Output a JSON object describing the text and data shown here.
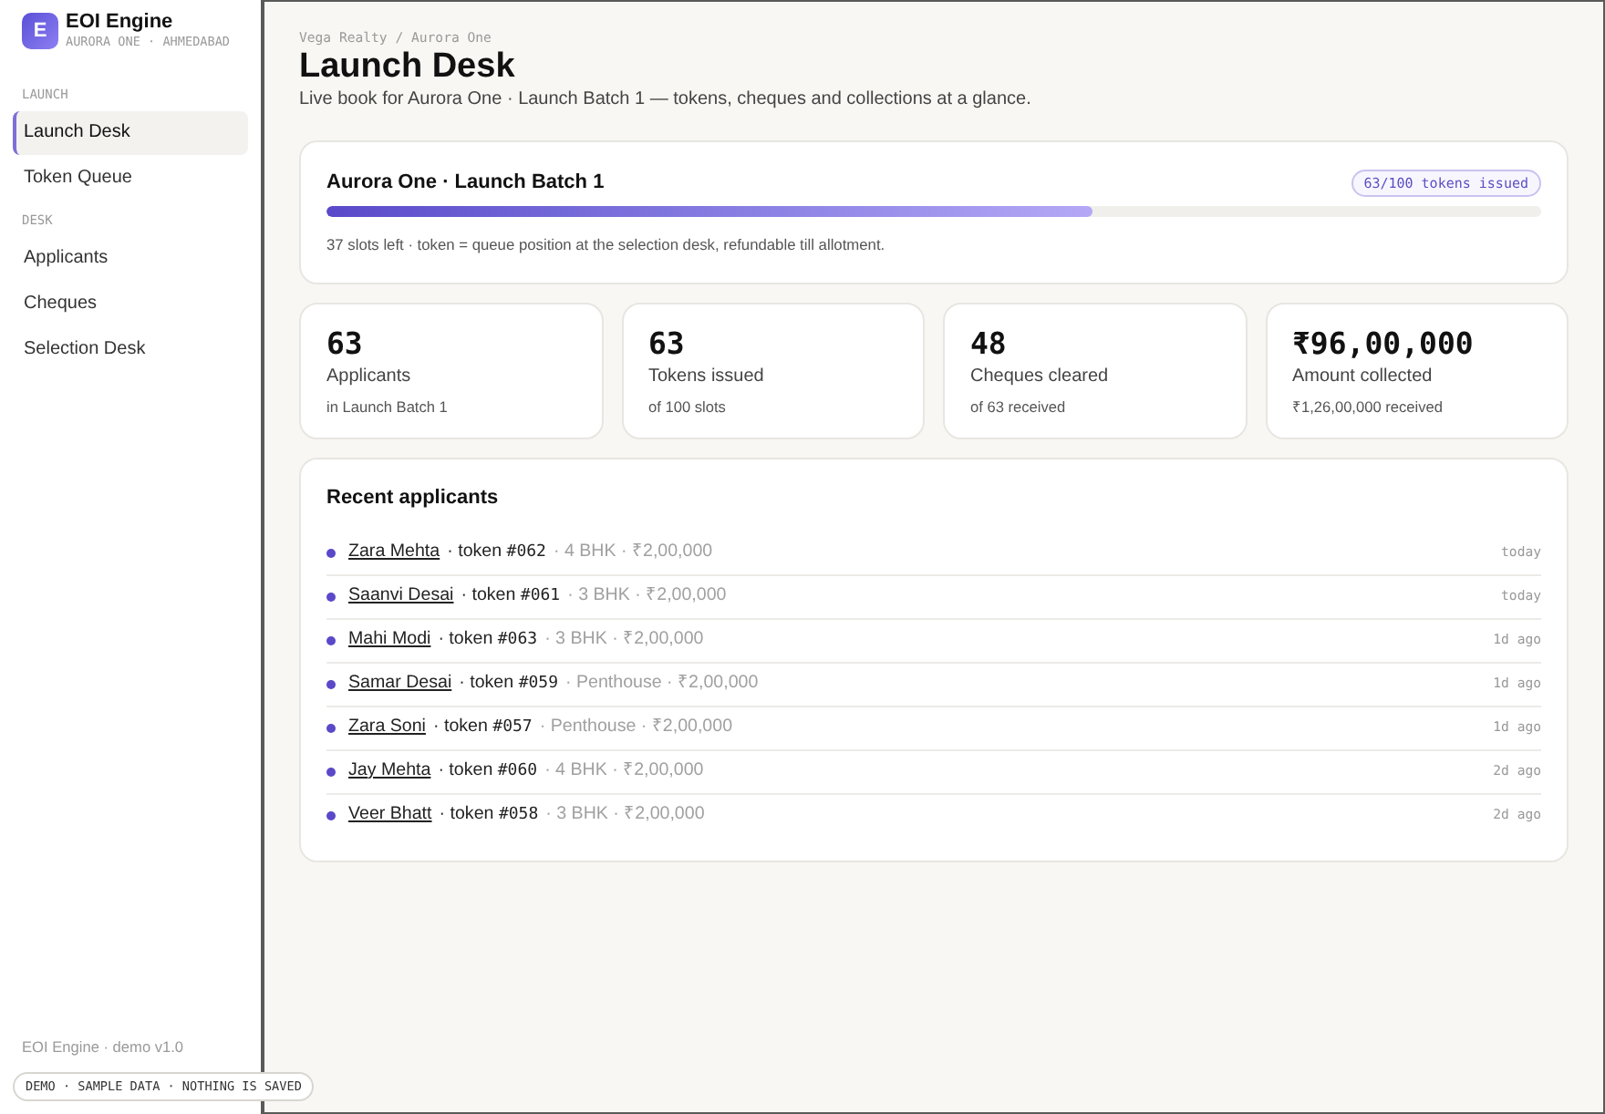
{
  "brand": {
    "logo_letter": "E",
    "name": "EOI Engine",
    "subtitle": "AURORA ONE · AHMEDABAD"
  },
  "sidebar": {
    "sections": [
      {
        "heading": "LAUNCH",
        "items": [
          {
            "label": "Launch Desk",
            "selected": true
          },
          {
            "label": "Token Queue",
            "selected": false
          }
        ]
      },
      {
        "heading": "DESK",
        "items": [
          {
            "label": "Applicants",
            "selected": false
          },
          {
            "label": "Cheques",
            "selected": false
          },
          {
            "label": "Selection Desk",
            "selected": false
          }
        ]
      }
    ],
    "footer": "EOI Engine · demo v1.0"
  },
  "demo_badge": "DEMO · SAMPLE DATA · NOTHING IS SAVED",
  "header": {
    "breadcrumb": "Vega Realty / Aurora One",
    "title": "Launch Desk",
    "subtitle": "Live book for Aurora One · Launch Batch 1 — tokens, cheques and collections at a glance."
  },
  "batch": {
    "title": "Aurora One · Launch Batch 1",
    "badge": "63/100 tokens issued",
    "level": 0.63,
    "note": "37 slots left · token = queue position at the selection desk, refundable till allotment."
  },
  "stats": [
    {
      "value": "63",
      "label": "Applicants",
      "detail": "in Launch Batch 1"
    },
    {
      "value": "63",
      "label": "Tokens issued",
      "detail": "of 100 slots"
    },
    {
      "value": "48",
      "label": "Cheques cleared",
      "detail": "of 63 received"
    },
    {
      "value": "₹96,00,000",
      "label": "Amount collected",
      "detail": "₹1,26,00,000 received"
    }
  ],
  "recent": {
    "title": "Recent applicants",
    "rows": [
      {
        "name": "Zara Mehta",
        "token_prefix": "· token",
        "token": "#062",
        "details": "· 4 BHK · ₹2,00,000",
        "time": "today"
      },
      {
        "name": "Saanvi Desai",
        "token_prefix": "· token",
        "token": "#061",
        "details": "· 3 BHK · ₹2,00,000",
        "time": "today"
      },
      {
        "name": "Mahi Modi",
        "token_prefix": "· token",
        "token": "#063",
        "details": "· 3 BHK · ₹2,00,000",
        "time": "1d ago"
      },
      {
        "name": "Samar Desai",
        "token_prefix": "· token",
        "token": "#059",
        "details": "· Penthouse · ₹2,00,000",
        "time": "1d ago"
      },
      {
        "name": "Zara Soni",
        "token_prefix": "· token",
        "token": "#057",
        "details": "· Penthouse · ₹2,00,000",
        "time": "1d ago"
      },
      {
        "name": "Jay Mehta",
        "token_prefix": "· token",
        "token": "#060",
        "details": "· 4 BHK · ₹2,00,000",
        "time": "2d ago"
      },
      {
        "name": "Veer Bhatt",
        "token_prefix": "· token",
        "token": "#058",
        "details": "· 3 BHK · ₹2,00,000",
        "time": "2d ago"
      }
    ]
  }
}
